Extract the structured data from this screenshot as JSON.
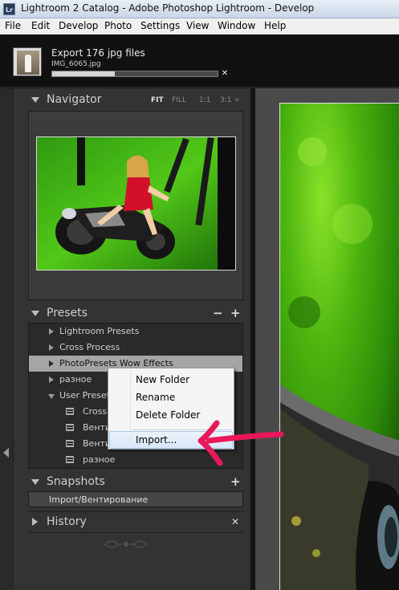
{
  "window": {
    "app_icon": "Lr",
    "title": "Lightroom 2 Catalog - Adobe Photoshop Lightroom - Develop"
  },
  "menu": [
    "File",
    "Edit",
    "Develop",
    "Photo",
    "Settings",
    "View",
    "Window",
    "Help"
  ],
  "activity": {
    "label": "Export 176 jpg files",
    "filename": "IMG_6065.jpg",
    "progress_fraction": 0.38,
    "cancel_glyph": "✕"
  },
  "navigator": {
    "title": "Navigator",
    "options": [
      "FIT",
      "FILL",
      "1:1",
      "3:1 ÷"
    ],
    "active_option": "FIT"
  },
  "presets": {
    "title": "Presets",
    "minus": "−",
    "plus": "+",
    "items": [
      {
        "label": "Lightroom Presets",
        "kind": "folder-closed"
      },
      {
        "label": "Cross Process",
        "kind": "folder-closed"
      },
      {
        "label": "PhotoPresets Wow Effects",
        "kind": "folder-selected"
      },
      {
        "label": "разное",
        "kind": "folder-closed"
      },
      {
        "label": "User Presets",
        "kind": "folder-open"
      },
      {
        "label": "Cross",
        "kind": "preset"
      },
      {
        "label": "Вентир",
        "kind": "preset"
      },
      {
        "label": "Вентир",
        "kind": "preset"
      },
      {
        "label": "разное",
        "kind": "preset"
      }
    ]
  },
  "snapshots": {
    "title": "Snapshots",
    "plus": "+",
    "items": [
      "Import/Вентирование"
    ]
  },
  "history": {
    "title": "History",
    "close": "✕"
  },
  "context_menu": {
    "items": [
      "New Folder",
      "Rename",
      "Delete Folder",
      "Import..."
    ],
    "highlighted": "Import..."
  },
  "colors": {
    "annotation_arrow": "#e8185a",
    "panel_bg": "#333333",
    "selected_row": "#a5a5a5"
  }
}
